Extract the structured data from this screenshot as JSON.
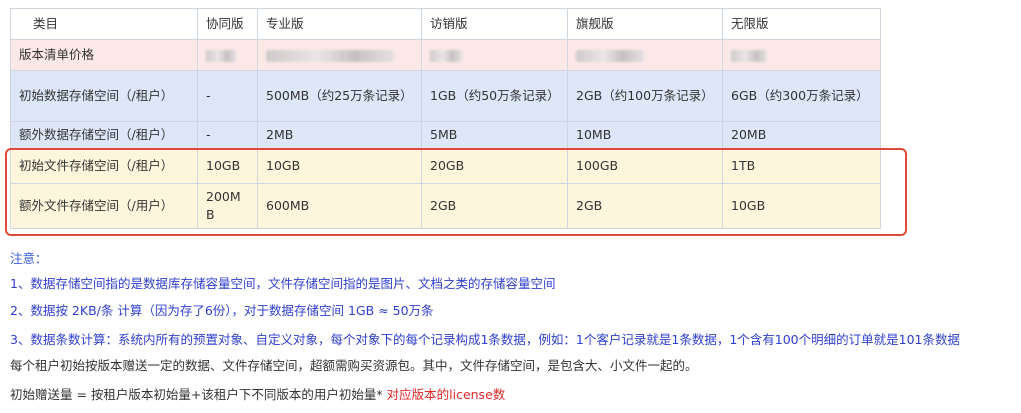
{
  "table": {
    "headers": [
      "类目",
      "协同版",
      "专业版",
      "访销版",
      "旗舰版",
      "无限版"
    ],
    "price_row_label": "版本清单价格",
    "rows": [
      {
        "label": "初始数据存储空间（/租户）",
        "cells": [
          "-",
          "500MB（约25万条记录）",
          "1GB（约50万条记录）",
          "2GB（约100万条记录）",
          "6GB（约300万条记录）"
        ]
      },
      {
        "label": "额外数据存储空间（/租户）",
        "cells": [
          "-",
          "2MB",
          "5MB",
          "10MB",
          "20MB"
        ]
      },
      {
        "label": "初始文件存储空间（/租户）",
        "cells": [
          "10GB",
          "10GB",
          "20GB",
          "100GB",
          "1TB"
        ]
      },
      {
        "label": "额外文件存储空间（/用户）",
        "cells": [
          "200MB",
          "600MB",
          "2GB",
          "2GB",
          "10GB"
        ]
      }
    ]
  },
  "notes": {
    "title": "注意：",
    "item1": "1、数据存储空间指的是数据库存储容量空间，文件存储空间指的是图片、文档之类的存储容量空间",
    "item2": "2、数据按 2KB/条 计算（因为存了6份），对于数据存储空间 1GB ≈ 50万条",
    "item3": "3、数据条数计算：系统内所有的预置对象、自定义对象，每个对象下的每个记录构成1条数据，例如：1个客户记录就是1条数据，1个含有100个明细的订单就是101条数据",
    "para1": "每个租户初始按版本赠送一定的数据、文件存储空间，超额需购买资源包。其中，文件存储空间，是包含大、小文件一起的。",
    "formula_prefix": "初始赠送量 = 按租户版本初始量+该租户下不同版本的用户初始量*",
    "formula_suffix": " 对应版本的license数"
  },
  "colors": {
    "price_row": "#fde8e8",
    "data_rows": "#dde7f9",
    "file_rows": "#fdf6dc",
    "highlight_border": "#e0483c",
    "note_blue": "#2f3fd0",
    "note_red": "#e02a2a"
  }
}
